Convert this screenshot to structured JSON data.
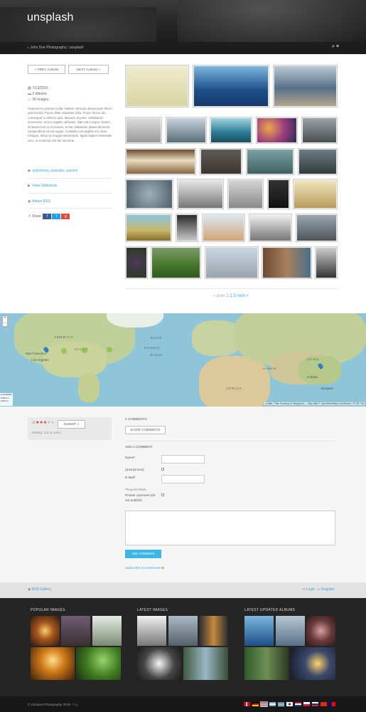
{
  "header": {
    "site_title": "unsplash",
    "breadcrumb_home": "John Doe Photography",
    "breadcrumb_sep": "/",
    "breadcrumb_current": "unsplash"
  },
  "album_nav": {
    "prev_label": "« PREV ALBUM",
    "next_label": "NEXT ALBUM »"
  },
  "album_meta": {
    "date": "7/13/2016",
    "albums": "2 albums",
    "images": "30 images"
  },
  "description": "Vivamus eu pretium nulla. Nullam vehicula ullamcorper libero quis lacinia. Fusce vitae vulputate odio. Fusce lectus dui, consequat in ultrices quis, aliquam at justo. Vestibulum accumsan, eros a sagittis vehicula, diam elit congue mauris, id laoreet est ex id mauris. In hac habitasse platea dictumst. Suspendisse at est augue. Curabitur vel sagittis est. Nam tristique, tellus ac feugiat elementum, ligula sapien venenatis arcu, ut euismod nisl dui sed ante.",
  "tags": [
    "astronomy",
    "australia",
    "autumn"
  ],
  "links": {
    "slideshow": "View Slideshow",
    "rss": "Album RSS",
    "share": "Share"
  },
  "pagination": {
    "prev": "« prev",
    "pages": [
      "1",
      "2",
      "3"
    ],
    "current": "1",
    "next": "next »"
  },
  "map": {
    "labels": [
      "North",
      "AMERICA",
      "United",
      "Atlantic",
      "Ocean",
      "AFRICA",
      "Arabia",
      "China",
      "Los Angeles",
      "San Francisco",
      "Kolkata",
      "Bangkok"
    ],
    "zoom_in": "+",
    "zoom_out": "−",
    "scale_lines": [
      "Unavailable",
      "1000 km",
      "1000 mi"
    ],
    "attribution": "Leaflet | Tiles Courtesy of MapQuest — Map data © OpenStreetMap contributors, CC-BY-SA"
  },
  "rating": {
    "submit_label": "SUBMIT »",
    "text": "Rating: 3.0 (1 vote)"
  },
  "comments": {
    "count_label": "2 COMMENTS",
    "show_label": "SHOW COMMENTS",
    "add_heading": "ADD A COMMENT",
    "name_label": "Name*",
    "anonymous_label": "(anonymous)",
    "email_label": "E-Mail*",
    "required_note": "*Required fields",
    "private_label": "Private comment (do not publish)",
    "submit_label": "ADD COMMENT",
    "subscribe_label": "Subscribe to comments"
  },
  "footer_bar": {
    "rss_label": "RSS Gallery",
    "login_label": "Login",
    "register_label": "Register"
  },
  "footer": {
    "popular_heading": "POPULAR IMAGES",
    "latest_heading": "LATEST IMAGES",
    "updated_heading": "LATEST UPDATED ALBUMS",
    "copyright": "© Libratus Photography 2015"
  },
  "colors": {
    "accent": "#36a9d6",
    "button": "#3cb6e3",
    "header_bg": "#1d1d1d",
    "footer_bg": "#252525"
  }
}
